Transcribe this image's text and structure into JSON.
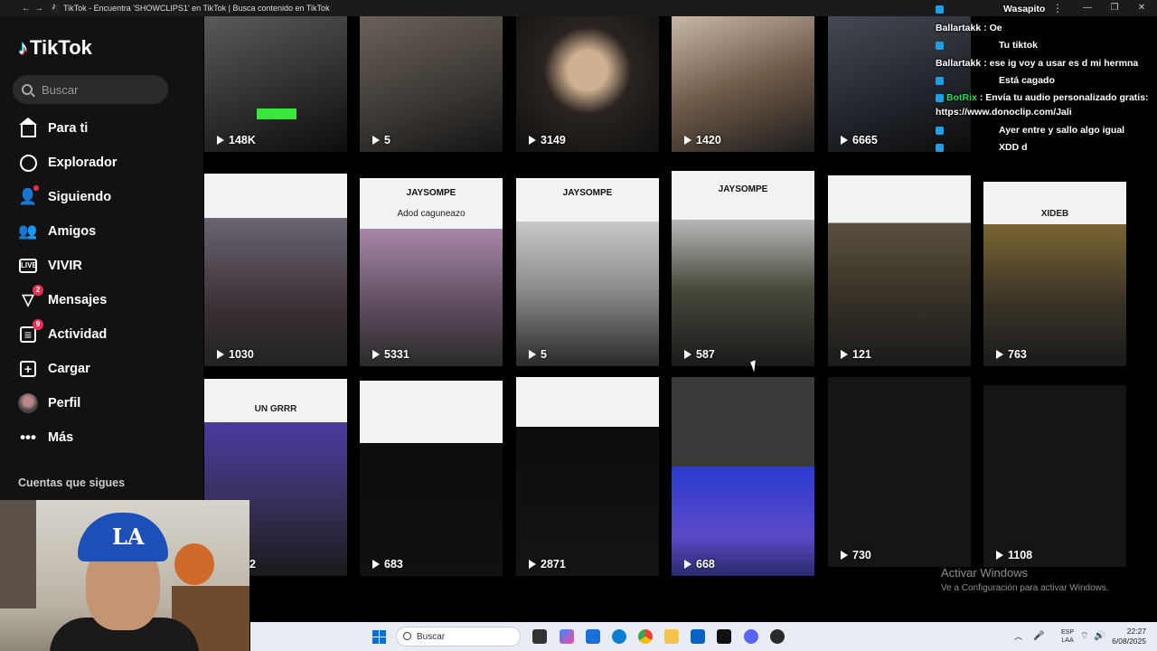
{
  "browser": {
    "title": "TikTok - Encuentra 'SHOWCLIPS1' en TikTok | Busca contenido en TikTok",
    "back_glyph": "←",
    "forward_glyph": "→",
    "minimize_glyph": "—",
    "maximize_glyph": "❐",
    "close_glyph": "✕"
  },
  "sidebar": {
    "logo": "TikTok",
    "search_placeholder": "Buscar",
    "items": [
      {
        "label": "Para ti",
        "icon": "home-icon"
      },
      {
        "label": "Explorador",
        "icon": "compass-icon"
      },
      {
        "label": "Siguiendo",
        "icon": "following-icon"
      },
      {
        "label": "Amigos",
        "icon": "friends-icon"
      },
      {
        "label": "VIVIR",
        "icon": "live-icon",
        "icon_text": "LIVE"
      },
      {
        "label": "Mensajes",
        "icon": "messages-icon",
        "badge": "2"
      },
      {
        "label": "Actividad",
        "icon": "activity-icon",
        "badge": "9"
      },
      {
        "label": "Cargar",
        "icon": "upload-icon"
      },
      {
        "label": "Perfil",
        "icon": "profile-avatar"
      },
      {
        "label": "Más",
        "icon": "more-icon"
      }
    ],
    "following_section": "Cuentas que sigues"
  },
  "grid": {
    "row1": [
      {
        "views": "148K"
      },
      {
        "views": "5"
      },
      {
        "views": "3149"
      },
      {
        "views": "1420"
      },
      {
        "views": "6665"
      }
    ],
    "row2": [
      {
        "views": "1030"
      },
      {
        "views": "5331",
        "strip": "JAYSOMPE",
        "caption": "Adod caguneazo"
      },
      {
        "views": "5",
        "strip": "JAYSOMPE"
      },
      {
        "views": "587",
        "strip": "JAYSOMPE"
      },
      {
        "views": "121"
      },
      {
        "views": "763",
        "caption": "XIDEB"
      }
    ],
    "row3": [
      {
        "views": "2",
        "caption": "UN GRRR"
      },
      {
        "views": "683"
      },
      {
        "views": "2871"
      },
      {
        "views": "668"
      },
      {
        "views": "730"
      },
      {
        "views": "1108"
      }
    ]
  },
  "chat": [
    {
      "name": "",
      "text": "Wasapito"
    },
    {
      "name": "Ballartakk",
      "text": "Oe"
    },
    {
      "name": "",
      "text": "Tu tiktok"
    },
    {
      "name": "Ballartakk",
      "text": "ese ig voy a usar es d mi hermna"
    },
    {
      "name": "",
      "text": "Está cagado"
    },
    {
      "name": "BotRix",
      "text": "Envía tu audio personalizado gratis:"
    },
    {
      "name": "",
      "text": "https://www.donoclip.com/Jali"
    },
    {
      "name": "",
      "text": "Ayer entre y sallo algo igual"
    },
    {
      "name": "",
      "text": "XDD d"
    }
  ],
  "watermark": {
    "title": "Activar Windows",
    "subtitle": "Ve a Configuración para activar Windows."
  },
  "taskbar": {
    "search_label": "Buscar",
    "lang": "ESP",
    "lang2": "LAA",
    "time": "22:27",
    "date": "6/08/2025"
  },
  "colors": {
    "accent": "#fe2c55",
    "chat_name": "#e02020",
    "bot_name": "#26d95a"
  }
}
